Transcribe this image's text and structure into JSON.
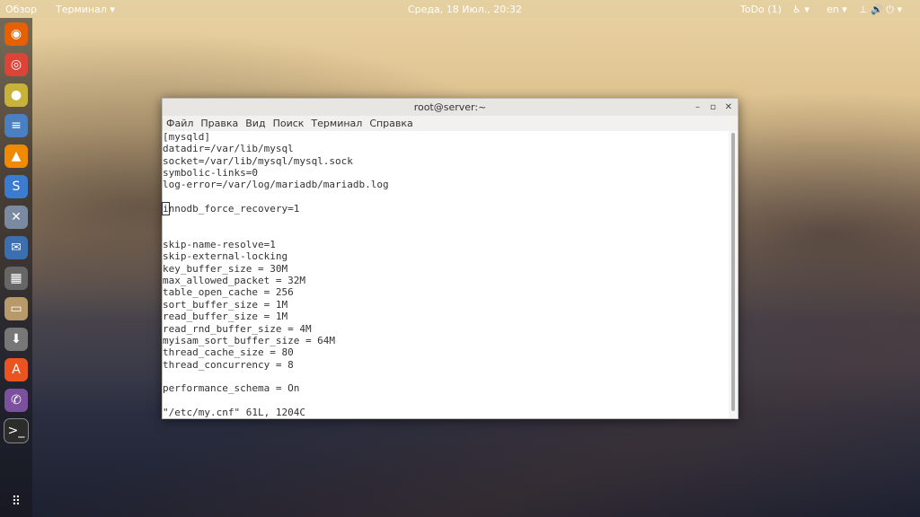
{
  "topbar": {
    "activities": "Обзор",
    "app_menu": "Терминал ▾",
    "clock": "Среда, 18 Июл., 20:32",
    "todo": "ToDo (1)",
    "accessibility": "♿ ▾",
    "lang": "en ▾",
    "system": "⊥ 🔊 ⏻ ▾"
  },
  "dock": [
    {
      "name": "firefox-icon",
      "glyph": "◉",
      "color": "#e66000"
    },
    {
      "name": "chrome-icon",
      "glyph": "◎",
      "color": "#db4437"
    },
    {
      "name": "media-player-icon",
      "glyph": "●",
      "color": "#c9b23a"
    },
    {
      "name": "text-editor-icon",
      "glyph": "≡",
      "color": "#4a7fc1"
    },
    {
      "name": "vlc-icon",
      "glyph": "▲",
      "color": "#f08a00"
    },
    {
      "name": "simplenote-icon",
      "glyph": "S",
      "color": "#3b7bd0"
    },
    {
      "name": "tools-icon",
      "glyph": "✕",
      "color": "#7a8aa0"
    },
    {
      "name": "thunderbird-icon",
      "glyph": "✉",
      "color": "#3b6fb0"
    },
    {
      "name": "calculator-icon",
      "glyph": "▦",
      "color": "#666"
    },
    {
      "name": "files-icon",
      "glyph": "▭",
      "color": "#b89a6a"
    },
    {
      "name": "installer-icon",
      "glyph": "⬇",
      "color": "#777"
    },
    {
      "name": "software-center-icon",
      "glyph": "A",
      "color": "#e95420"
    },
    {
      "name": "viber-icon",
      "glyph": "✆",
      "color": "#7b519d"
    },
    {
      "name": "terminal-icon",
      "glyph": ">_",
      "color": "#2c2c2c"
    },
    {
      "name": "show-apps-icon",
      "glyph": "⠿",
      "color": "transparent"
    }
  ],
  "window": {
    "title": "root@server:~",
    "menu": [
      "Файл",
      "Правка",
      "Вид",
      "Поиск",
      "Терминал",
      "Справка"
    ],
    "lines": [
      "[mysqld]",
      "datadir=/var/lib/mysql",
      "socket=/var/lib/mysql/mysql.sock",
      "symbolic-links=0",
      "log-error=/var/log/mariadb/mariadb.log",
      "",
      "innodb_force_recovery=1",
      "",
      "",
      "skip-name-resolve=1",
      "skip-external-locking",
      "key_buffer_size = 30M",
      "max_allowed_packet = 32M",
      "table_open_cache = 256",
      "sort_buffer_size = 1M",
      "read_buffer_size = 1M",
      "read_rnd_buffer_size = 4M",
      "myisam_sort_buffer_size = 64M",
      "thread_cache_size = 80",
      "thread_concurrency = 8",
      "",
      "performance_schema = On",
      "",
      "\"/etc/my.cnf\" 61L, 1204C"
    ]
  }
}
